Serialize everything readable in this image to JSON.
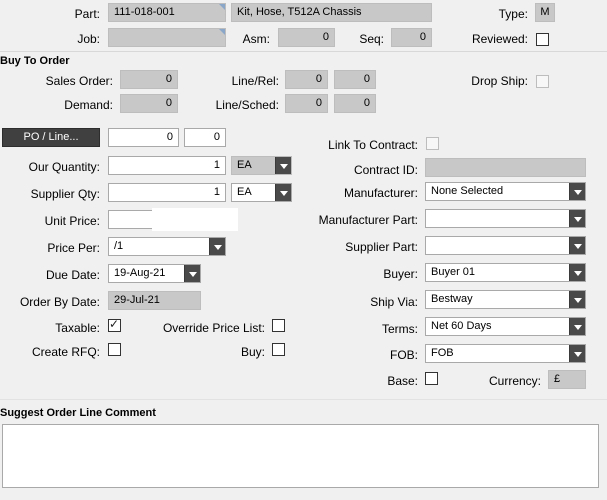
{
  "header": {
    "part_label": "Part:",
    "part_value": "111-018-001",
    "part_desc": "Kit, Hose, T512A Chassis",
    "type_label": "Type:",
    "type_value": "M",
    "job_label": "Job:",
    "job_value": "",
    "asm_label": "Asm:",
    "asm_value": "0",
    "seq_label": "Seq:",
    "seq_value": "0",
    "reviewed_label": "Reviewed:",
    "reviewed_checked": false
  },
  "buy_to_order": {
    "title": "Buy To Order",
    "sales_order_label": "Sales Order:",
    "sales_order_value": "0",
    "line_rel_label": "Line/Rel:",
    "line_value": "0",
    "rel_value": "0",
    "drop_ship_label": "Drop Ship:",
    "demand_label": "Demand:",
    "demand_value": "0",
    "line_sched_label": "Line/Sched:",
    "line2_value": "0",
    "sched_value": "0"
  },
  "left": {
    "po_line_button": "PO / Line...",
    "po_value": "0",
    "line_value": "0",
    "our_qty_label": "Our Quantity:",
    "our_qty_value": "1",
    "our_qty_uom": "EA",
    "supplier_qty_label": "Supplier Qty:",
    "supplier_qty_value": "1",
    "supplier_qty_uom": "EA",
    "unit_price_label": "Unit Price:",
    "unit_price_value": "",
    "price_per_label": "Price Per:",
    "price_per_value": "/1",
    "due_date_label": "Due Date:",
    "due_date_value": "19-Aug-21",
    "order_by_label": "Order By Date:",
    "order_by_value": "29-Jul-21",
    "taxable_label": "Taxable:",
    "taxable_checked": true,
    "override_label": "Override Price List:",
    "create_rfq_label": "Create RFQ:",
    "buy_label": "Buy:"
  },
  "right": {
    "link_contract_label": "Link To Contract:",
    "contract_id_label": "Contract ID:",
    "contract_id_value": "",
    "manufacturer_label": "Manufacturer:",
    "manufacturer_value": "None Selected",
    "mfr_part_label": "Manufacturer Part:",
    "mfr_part_value": "",
    "supplier_part_label": "Supplier Part:",
    "supplier_part_value": "",
    "buyer_label": "Buyer:",
    "buyer_value": "Buyer 01",
    "ship_via_label": "Ship Via:",
    "ship_via_value": "Bestway",
    "terms_label": "Terms:",
    "terms_value": "Net 60 Days",
    "fob_label": "FOB:",
    "fob_value": "FOB",
    "base_label": "Base:",
    "currency_label": "Currency:",
    "currency_value": "£"
  },
  "comment": {
    "title": "Suggest Order Line Comment",
    "value": ""
  },
  "colors": {
    "background": "#f0f0f0",
    "readonly_field": "#c8c8c8",
    "button_dark": "#404040"
  }
}
